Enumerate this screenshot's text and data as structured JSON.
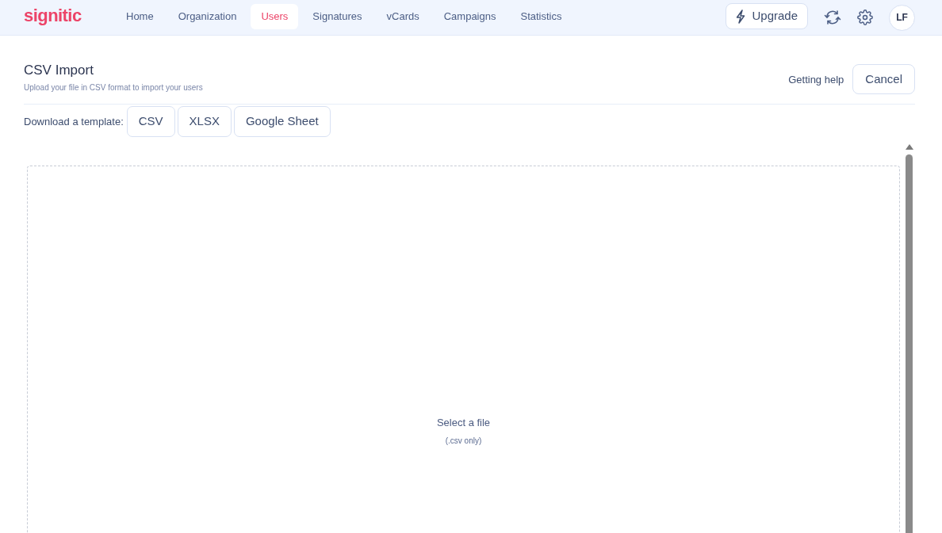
{
  "logo": "signitic",
  "nav": [
    {
      "label": "Home",
      "selected": false
    },
    {
      "label": "Organization",
      "selected": false
    },
    {
      "label": "Users",
      "selected": true
    },
    {
      "label": "Signatures",
      "selected": false
    },
    {
      "label": "vCards",
      "selected": false
    },
    {
      "label": "Campaigns",
      "selected": false
    },
    {
      "label": "Statistics",
      "selected": false
    }
  ],
  "upgrade_button": "Upgrade",
  "avatar": "LF",
  "page": {
    "title": "CSV Import",
    "subtitle": "Upload your file in CSV format to import your users",
    "help_link": "Getting help",
    "cancel_button": "Cancel"
  },
  "templates": {
    "label": "Download a template:",
    "buttons": [
      "CSV",
      "XLSX",
      "Google Sheet"
    ]
  },
  "dropzone": {
    "prompt": "Select a file",
    "hint": "(.csv only)"
  }
}
